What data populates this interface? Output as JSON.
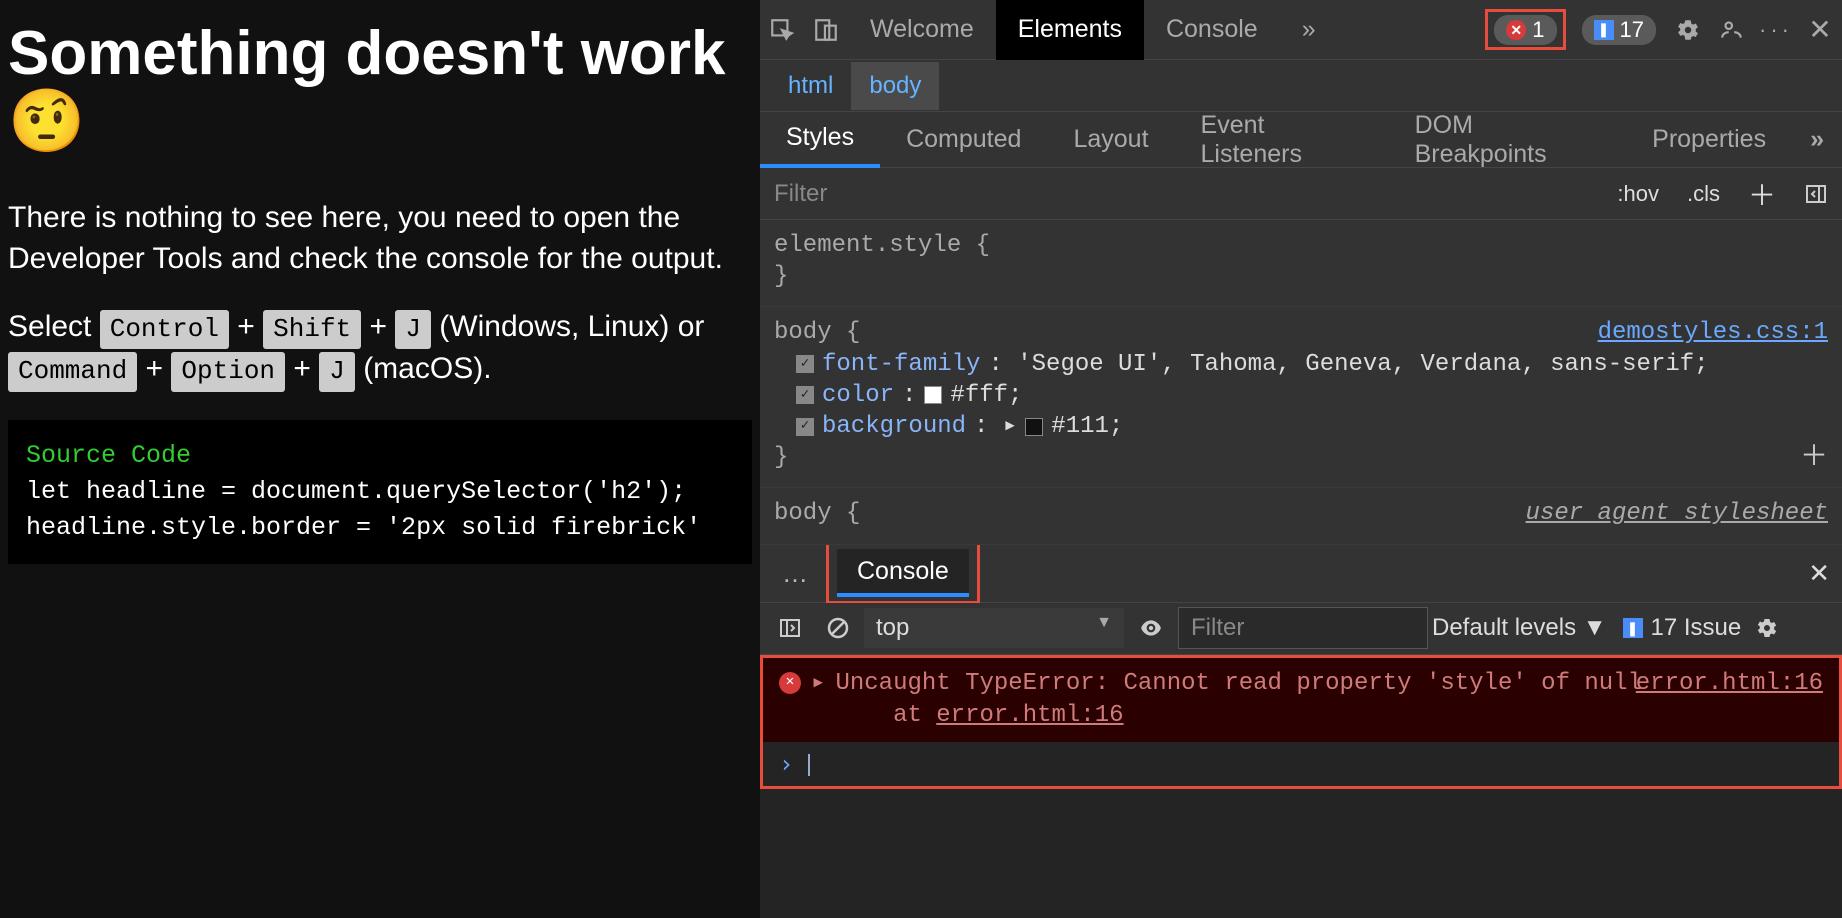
{
  "page": {
    "heading": "Something doesn't work 🤨",
    "intro": "There is nothing to see here, you need to open the Developer Tools and check the console for the output.",
    "shortcut_pre": "Select ",
    "k_control": "Control",
    "k_shift": "Shift",
    "k_j": "J",
    "win_lin": " (Windows, Linux) or ",
    "k_command": "Command",
    "k_option": "Option",
    "macos": " (macOS).",
    "plus": " + ",
    "code_header": "Source Code",
    "code_l1": "let headline = document.querySelector('h2');",
    "code_l2": "headline.style.border = '2px solid firebrick'"
  },
  "devtools": {
    "tabs": {
      "welcome": "Welcome",
      "elements": "Elements",
      "console": "Console",
      "more": "»"
    },
    "errors": "1",
    "issues": "17",
    "breadcrumbs": {
      "html": "html",
      "body": "body"
    },
    "styles_tabs": {
      "styles": "Styles",
      "computed": "Computed",
      "layout": "Layout",
      "listeners": "Event Listeners",
      "dom_bp": "DOM Breakpoints",
      "props": "Properties",
      "more": "»"
    },
    "filter_placeholder": "Filter",
    "hov": ":hov",
    "cls": ".cls",
    "rule_elstyle_sel": "element.style {",
    "rule_close": "}",
    "rule_body_sel": "body {",
    "body_src": "demostyles.css:1",
    "body_ff_prop": "font-family",
    "body_ff_val": ": 'Segoe UI', Tahoma, Geneva, Verdana, sans-serif;",
    "body_color_prop": "color",
    "body_color_val": "#fff;",
    "body_bg_prop": "background",
    "body_bg_val": "#111;",
    "ua_label": "user agent stylesheet",
    "console_tab": "Console",
    "ctx": "top",
    "filter2": "Filter",
    "levels": "Default levels ▼",
    "issue_count": "17 Issue",
    "error_text": "Uncaught TypeError: Cannot read property 'style' of null",
    "error_at": "at ",
    "error_loc": "error.html:16",
    "prompt": "›"
  }
}
